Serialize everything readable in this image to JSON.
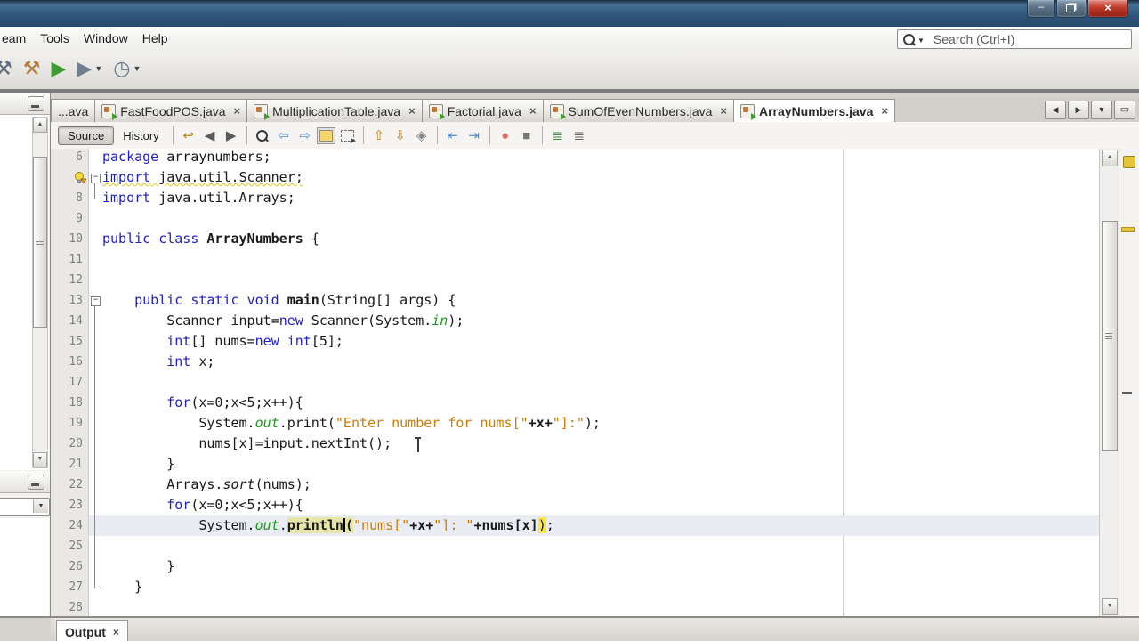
{
  "titlebar": {
    "window_buttons": [
      {
        "name": "minimize-button",
        "glyph": "–"
      },
      {
        "name": "restore-button",
        "glyph": ""
      },
      {
        "name": "close-button",
        "glyph": "×"
      }
    ]
  },
  "menubar": {
    "items": [
      {
        "name": "menu-item-team",
        "label": "eam"
      },
      {
        "name": "menu-item-tools",
        "label": "Tools"
      },
      {
        "name": "menu-item-window",
        "label": "Window"
      },
      {
        "name": "menu-item-help",
        "label": "Help"
      }
    ],
    "search_placeholder": "Search (Ctrl+I)"
  },
  "main_toolbar": {
    "icons": [
      {
        "name": "build-project-icon",
        "glyph": "⚒",
        "color": "#5b6e84",
        "partial": true
      },
      {
        "name": "clean-build-project-icon",
        "glyph": "⚒",
        "color": "#b07c3a"
      },
      {
        "name": "run-project-icon",
        "glyph": "▶",
        "color": "#3f9b33"
      },
      {
        "name": "debug-project-icon",
        "glyph": "▶",
        "color": "#6f7f90",
        "caret": true
      },
      {
        "name": "profile-project-icon",
        "glyph": "◷",
        "color": "#667788",
        "caret": true
      }
    ]
  },
  "tab_bar": {
    "overflow_label": "...ava",
    "tabs": [
      {
        "label": "FastFoodPOS.java",
        "active": false
      },
      {
        "label": "MultiplicationTable.java",
        "active": false
      },
      {
        "label": "Factorial.java",
        "active": false
      },
      {
        "label": "SumOfEvenNumbers.java",
        "active": false
      },
      {
        "label": "ArrayNumbers.java",
        "active": true
      }
    ],
    "controls": [
      {
        "name": "scroll-tabs-left-button",
        "glyph": "◀"
      },
      {
        "name": "scroll-tabs-right-button",
        "glyph": "▶"
      },
      {
        "name": "tab-list-button",
        "glyph": "▼"
      },
      {
        "name": "maximize-window-button",
        "glyph": "▭"
      }
    ]
  },
  "editor_toolbar": {
    "source_label": "Source",
    "history_label": "History",
    "icons": [
      {
        "name": "last-edit-icon",
        "glyph": "↩",
        "color": "#c08619"
      },
      {
        "name": "back-icon",
        "glyph": "◀",
        "color": "#5a5a5a",
        "caret": true
      },
      {
        "name": "forward-icon",
        "glyph": "▶",
        "color": "#5a5a5a",
        "caret": true
      },
      {
        "sep": true
      },
      {
        "name": "find-selection-icon",
        "shape": "mag"
      },
      {
        "name": "find-previous-icon",
        "glyph": "⇦",
        "color": "#4d8fd1"
      },
      {
        "name": "find-next-icon",
        "glyph": "⇨",
        "color": "#4d8fd1"
      },
      {
        "name": "toggle-highlight-icon",
        "shape": "hl"
      },
      {
        "name": "rectangular-selection-icon",
        "shape": "dash"
      },
      {
        "sep": true
      },
      {
        "name": "previous-bookmark-icon",
        "glyph": "⇧",
        "color": "#c08619"
      },
      {
        "name": "next-bookmark-icon",
        "glyph": "⇩",
        "color": "#c08619"
      },
      {
        "name": "goto-bookmark-icon",
        "glyph": "◈",
        "color": "#888888"
      },
      {
        "sep": true
      },
      {
        "name": "shift-line-left-icon",
        "glyph": "⇤",
        "color": "#4d8fd1"
      },
      {
        "name": "shift-line-right-icon",
        "glyph": "⇥",
        "color": "#4d8fd1"
      },
      {
        "sep": true
      },
      {
        "name": "start-macro-recording-icon",
        "glyph": "●",
        "color": "#e2716a"
      },
      {
        "name": "stop-macro-recording-icon",
        "glyph": "■",
        "color": "#777777"
      },
      {
        "sep": true
      },
      {
        "name": "comment-icon",
        "glyph": "≣",
        "color": "#3c8a3c"
      },
      {
        "name": "uncomment-icon",
        "glyph": "≣",
        "color": "#666666"
      }
    ]
  },
  "editor": {
    "current_line": 24,
    "lines": [
      {
        "n": 6,
        "tokens": [
          [
            "kw",
            "package"
          ],
          [
            "pl",
            " arraynumbers;"
          ]
        ]
      },
      {
        "n": 7,
        "fold": "start",
        "warn": true,
        "gutterIcon": "lightbulb-warning",
        "tokens": [
          [
            "kw",
            "import"
          ],
          [
            "pl",
            " java.util.Scanner;"
          ]
        ]
      },
      {
        "n": 8,
        "fold": "end",
        "tokens": [
          [
            "kw",
            "import"
          ],
          [
            "pl",
            " java.util.Arrays;"
          ]
        ]
      },
      {
        "n": 9,
        "tokens": []
      },
      {
        "n": 10,
        "tokens": [
          [
            "kw",
            "public"
          ],
          [
            "pl",
            " "
          ],
          [
            "kw",
            "class"
          ],
          [
            "pl",
            " "
          ],
          [
            "b",
            "ArrayNumbers"
          ],
          [
            "pl",
            " {"
          ]
        ]
      },
      {
        "n": 11,
        "tokens": []
      },
      {
        "n": 12,
        "tokens": []
      },
      {
        "n": 13,
        "fold": "start",
        "tokens": [
          [
            "pl",
            "    "
          ],
          [
            "kw",
            "public"
          ],
          [
            "pl",
            " "
          ],
          [
            "kw",
            "static"
          ],
          [
            "pl",
            " "
          ],
          [
            "kw",
            "void"
          ],
          [
            "pl",
            " "
          ],
          [
            "b",
            "main"
          ],
          [
            "pl",
            "(String[] args) {"
          ]
        ]
      },
      {
        "n": 14,
        "fold": "mid",
        "tokens": [
          [
            "pl",
            "        Scanner input="
          ],
          [
            "kw",
            "new"
          ],
          [
            "pl",
            " Scanner(System."
          ],
          [
            "fld",
            "in"
          ],
          [
            "pl",
            ");"
          ]
        ]
      },
      {
        "n": 15,
        "fold": "mid",
        "tokens": [
          [
            "pl",
            "        "
          ],
          [
            "kw",
            "int"
          ],
          [
            "pl",
            "[] nums="
          ],
          [
            "kw",
            "new"
          ],
          [
            "pl",
            " "
          ],
          [
            "kw",
            "int"
          ],
          [
            "pl",
            "[5];"
          ]
        ]
      },
      {
        "n": 16,
        "fold": "mid",
        "tokens": [
          [
            "pl",
            "        "
          ],
          [
            "kw",
            "int"
          ],
          [
            "pl",
            " x;"
          ]
        ]
      },
      {
        "n": 17,
        "fold": "mid",
        "tokens": []
      },
      {
        "n": 18,
        "fold": "mid",
        "tokens": [
          [
            "pl",
            "        "
          ],
          [
            "kw",
            "for"
          ],
          [
            "pl",
            "(x=0;x<5;x++){"
          ]
        ]
      },
      {
        "n": 19,
        "fold": "mid",
        "tokens": [
          [
            "pl",
            "            System."
          ],
          [
            "fld",
            "out"
          ],
          [
            "pl",
            ".print("
          ],
          [
            "str",
            "\"Enter number for nums[\""
          ],
          [
            "b",
            "+x+"
          ],
          [
            "str",
            "\"]:\""
          ],
          [
            "pl",
            ");"
          ]
        ]
      },
      {
        "n": 20,
        "fold": "mid",
        "tokens": [
          [
            "pl",
            "            nums[x]=input.nextInt();"
          ]
        ]
      },
      {
        "n": 21,
        "fold": "mid",
        "tokens": [
          [
            "pl",
            "        }"
          ]
        ]
      },
      {
        "n": 22,
        "fold": "mid",
        "tokens": [
          [
            "pl",
            "        Arrays."
          ],
          [
            "it",
            "sort"
          ],
          [
            "pl",
            "(nums);"
          ]
        ]
      },
      {
        "n": 23,
        "fold": "mid",
        "tokens": [
          [
            "pl",
            "        "
          ],
          [
            "kw",
            "for"
          ],
          [
            "pl",
            "(x=0;x<5;x++){"
          ]
        ]
      },
      {
        "n": 24,
        "fold": "mid",
        "current": true,
        "tokens": [
          [
            "pl",
            "            System."
          ],
          [
            "fld",
            "out"
          ],
          [
            "pl",
            "."
          ],
          [
            "occ",
            "println"
          ],
          [
            "caret",
            ""
          ],
          [
            "occ",
            "("
          ],
          [
            "str",
            "\"nums[\""
          ],
          [
            "b",
            "+x+"
          ],
          [
            "str",
            "\"]: \""
          ],
          [
            "b",
            "+nums[x]"
          ],
          [
            "br",
            ")"
          ],
          [
            "pl",
            ";"
          ]
        ]
      },
      {
        "n": 25,
        "fold": "mid",
        "tokens": []
      },
      {
        "n": 26,
        "fold": "mid",
        "tokens": [
          [
            "pl",
            "        }"
          ]
        ]
      },
      {
        "n": 27,
        "fold": "end",
        "tokens": [
          [
            "pl",
            "    }"
          ]
        ]
      },
      {
        "n": 28,
        "tokens": []
      }
    ]
  },
  "output": {
    "tab_label": "Output",
    "close_glyph": "×"
  }
}
